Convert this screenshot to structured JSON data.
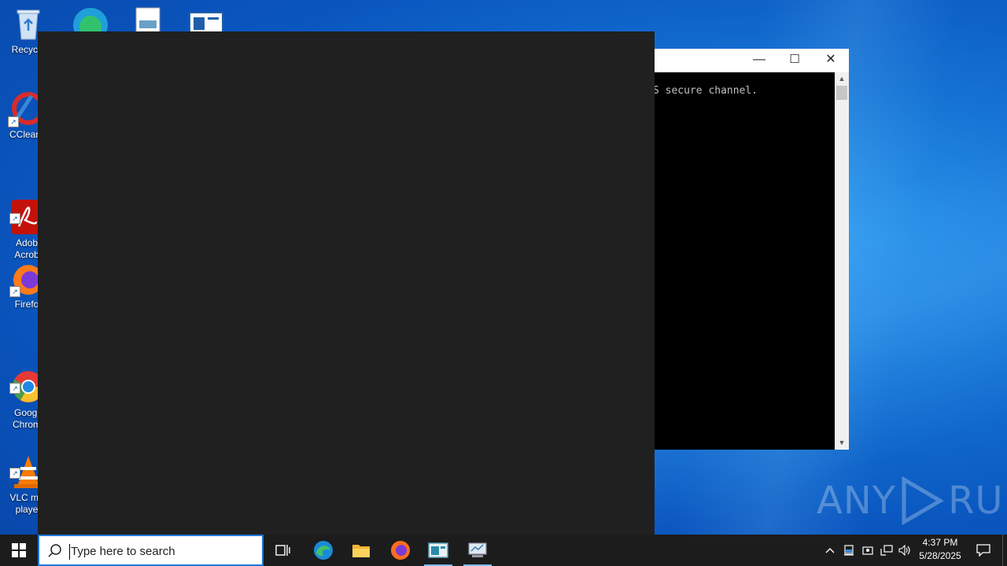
{
  "desktop": {
    "icons": [
      {
        "id": "recycle",
        "label": "Recycle"
      },
      {
        "id": "ccleaner",
        "label": "CClean"
      },
      {
        "id": "adobe",
        "label": "Adob\nAcrob"
      },
      {
        "id": "firefox",
        "label": "Firefo"
      },
      {
        "id": "chrome",
        "label": "Googl\nChrom"
      },
      {
        "id": "vlc",
        "label": "VLC me\nplaye"
      }
    ]
  },
  "console": {
    "text": "S secure channel.",
    "controls": {
      "minimize": "—",
      "maximize": "☐",
      "close": "✕"
    }
  },
  "watermark": {
    "left": "ANY",
    "right": "RUN"
  },
  "taskbar": {
    "search_placeholder": "Type here to search",
    "clock_time": "4:37 PM",
    "clock_date": "5/28/2025",
    "pinned": [
      "task-view",
      "edge",
      "file-explorer",
      "firefox",
      "app-window",
      "network-app"
    ]
  }
}
